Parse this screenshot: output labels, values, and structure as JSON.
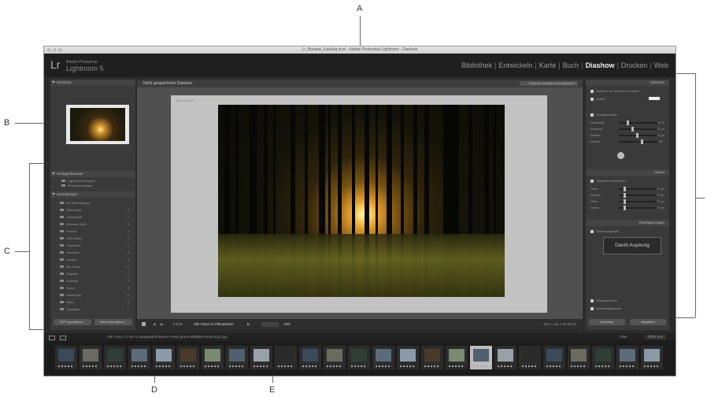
{
  "annotations": {
    "a": "A",
    "b": "B",
    "c": "C",
    "d": "D",
    "e": "E"
  },
  "window": {
    "title": "Lr_Beispiel_Katalog.lrcat - Adobe Photoshop Lightroom - Diashow"
  },
  "brand": {
    "logo": "Lr",
    "product_small": "Adobe Photoshop",
    "product_name": "Lightroom 5"
  },
  "modules": [
    {
      "label": "Bibliothek",
      "active": false
    },
    {
      "label": "Entwickeln",
      "active": false
    },
    {
      "label": "Karte",
      "active": false
    },
    {
      "label": "Buch",
      "active": false
    },
    {
      "label": "Diashow",
      "active": true
    },
    {
      "label": "Drucken",
      "active": false
    },
    {
      "label": "Web",
      "active": false
    }
  ],
  "left_panel": {
    "preview_header": "Vorschau",
    "template_browser_header": "Vorlagenbrowser",
    "templates": [
      "Lightroom-Vorlagen",
      "Benutzervorlagen"
    ],
    "collections_header": "Sammlungen",
    "collections": [
      {
        "label": "Ich Sammlungen",
        "count": ""
      },
      {
        "label": "Hochzeiten",
        "count": "3"
      },
      {
        "label": "Landschaft",
        "count": "7"
      },
      {
        "label": "Schwarz-Weiß",
        "count": "5"
      },
      {
        "label": "Portrait",
        "count": "4"
      },
      {
        "label": "HDR-Bilder",
        "count": "2"
      },
      {
        "label": "Panorama",
        "count": "6"
      },
      {
        "label": "Favoriten",
        "count": "8"
      },
      {
        "label": "Kunden",
        "count": "3"
      },
      {
        "label": "Alle Fotos",
        "count": "14"
      },
      {
        "label": "Projekte",
        "count": "2"
      },
      {
        "label": "Auswahl",
        "count": "5"
      },
      {
        "label": "Kunst",
        "count": "9"
      },
      {
        "label": "Reisefotos",
        "count": "6"
      },
      {
        "label": "Natur",
        "count": "2"
      },
      {
        "label": "Sonstiges",
        "count": "1"
      }
    ],
    "export_pdf_button": "PDF exportieren...",
    "export_video_button": "Video exportieren..."
  },
  "center": {
    "header_title": "Nicht gespeicherte Diashow",
    "header_button": "Diashow erstellen und speichern",
    "slide_title": "Slide Preview",
    "toolbar_content_label": "Inhalt:",
    "toolbar_content_value": "Alle Fotos im Filmstreifen",
    "toolbar_aa": "ABC",
    "toolbar_right": "Dia 1 von 1   00:00:04"
  },
  "right_panel": {
    "options_header": "Optionen",
    "zoom_label": "Zoomen, um Rahmen zu füllen",
    "stroke_label": "Kontur",
    "cast_shadow_label": "Schlagschatten",
    "shadow_rows": [
      "Deckkraft",
      "Abstand",
      "Radius",
      "Winkel"
    ],
    "shadow_values": [
      "30 %",
      "10 px",
      "20 px",
      "-45 °"
    ],
    "layout_header": "Layout",
    "guides_label": "Hilfslinien einblenden",
    "guide_rows": [
      "Links",
      "Rechts",
      "Oben",
      "Unten"
    ],
    "guide_values": [
      "50 px",
      "50 px",
      "50 px",
      "50 px"
    ],
    "overlays_header": "Überlagerungen",
    "identity_label": "Erkennungstafel",
    "identity_text": "David Auyeung",
    "watermark_label": "Wasserzeichen",
    "rating_label": "Bewertungssterne",
    "preview_button": "Vorschau",
    "play_button": "Abspielen"
  },
  "filmstrip": {
    "info": "Alle Fotos   1 Foto /1 ausgewählt /Deam Forest green 6008840-0000.4112.jpg",
    "filter_label": "Filter:",
    "filter_value": "Filter aus",
    "thumbnail_count": 25
  }
}
